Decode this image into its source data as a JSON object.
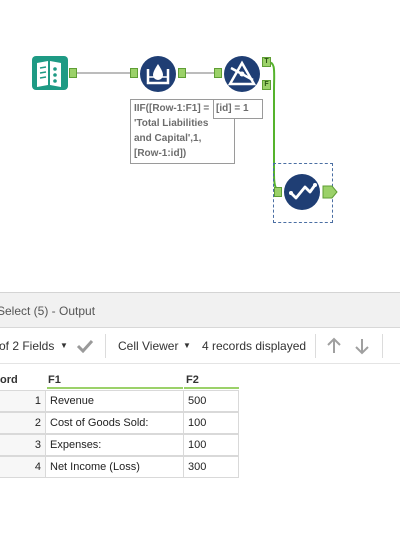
{
  "workflow": {
    "annotation_lines": [
      "IIF([Row-1:F1] =",
      "'Total Liabilities",
      "and Capital',1,",
      "[Row-1:id])"
    ],
    "annotation2": "[id] = 1",
    "filter_true_label": "T",
    "filter_false_label": "F",
    "tools": [
      {
        "name": "input",
        "color": "#1e9a84",
        "icon": "book-icon"
      },
      {
        "name": "multi-row-formula",
        "color": "#1f3e74",
        "icon": "multi-row-icon"
      },
      {
        "name": "filter",
        "color": "#1f3e74",
        "icon": "filter-icon"
      },
      {
        "name": "select",
        "color": "#1f3e74",
        "icon": "checkmark-icon"
      }
    ],
    "colors": {
      "anchor": "#9bd169",
      "connector_gray": "#a6a6a6",
      "connector_green": "#55b32c"
    }
  },
  "results": {
    "title": "Select (5) - Output",
    "fields_label": "of 2 Fields",
    "cell_viewer_label": "Cell Viewer",
    "records_label": "4 records displayed",
    "columns": [
      "ord",
      "F1",
      "F2"
    ],
    "rows": [
      {
        "num": "1",
        "f1": "Revenue",
        "f2": "500"
      },
      {
        "num": "2",
        "f1": "Cost of Goods Sold:",
        "f2": "100"
      },
      {
        "num": "3",
        "f1": "Expenses:",
        "f2": "100"
      },
      {
        "num": "4",
        "f1": "Net Income (Loss)",
        "f2": "300"
      }
    ]
  }
}
